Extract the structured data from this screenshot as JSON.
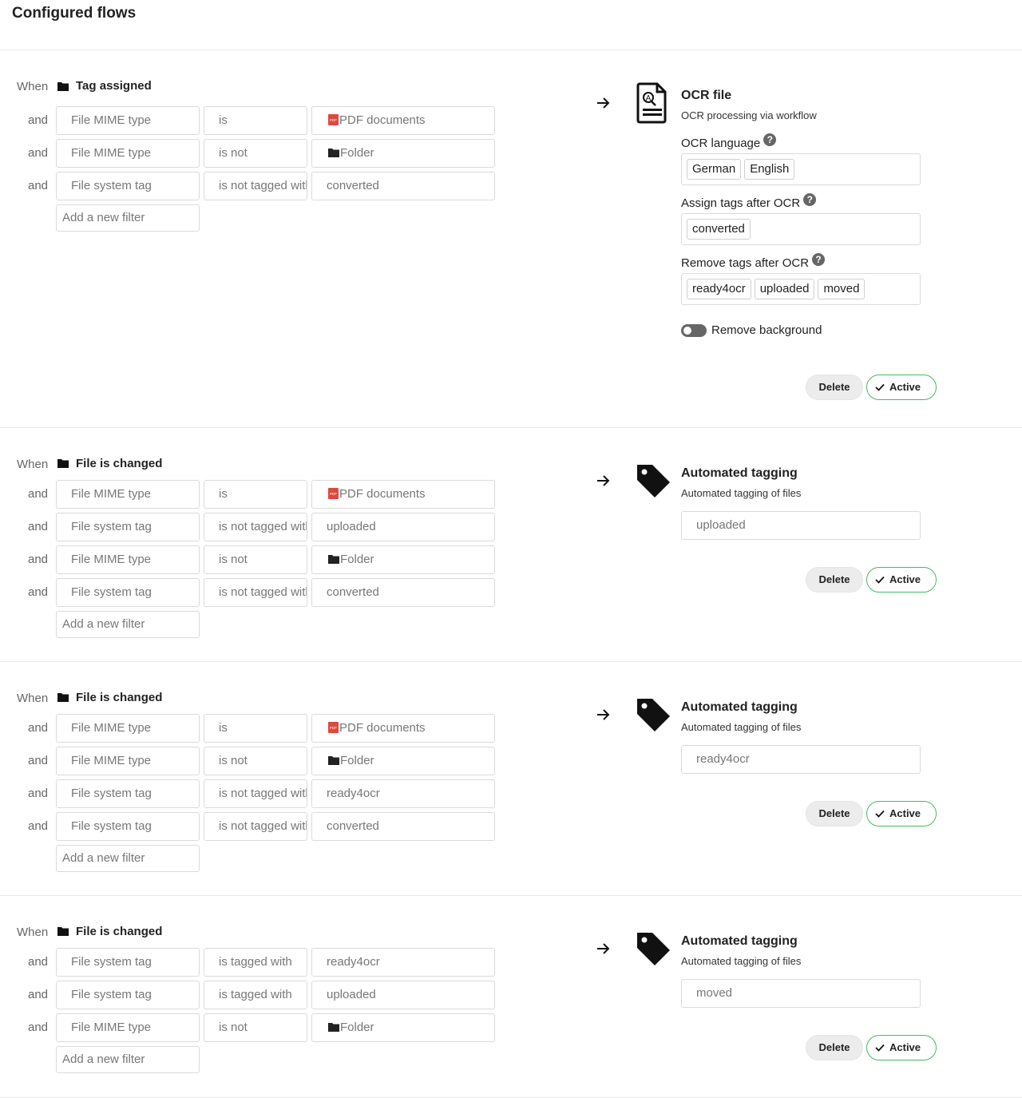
{
  "page": {
    "title": "Configured flows"
  },
  "icons": {
    "folder": "folder-icon",
    "pdf": "pdf-file-icon",
    "arrow": "arrow-right-icon",
    "ocr": "ocr-document-icon",
    "tag": "tag-icon",
    "check": "check-icon",
    "help": "help-icon"
  },
  "colors": {
    "active_border": "#46ba61",
    "pdf_red": "#e0483e"
  },
  "labels": {
    "when": "When",
    "and": "and",
    "add_filter_placeholder": "Add a new filter",
    "delete": "Delete",
    "active": "Active",
    "help": "?"
  },
  "flows": [
    {
      "event": "Tag assigned",
      "checks": [
        {
          "check": "File MIME type",
          "operator": "is",
          "value": "PDF documents",
          "value_icon": "pdf"
        },
        {
          "check": "File MIME type",
          "operator": "is not",
          "value": "Folder",
          "value_icon": "folder"
        },
        {
          "check": "File system tag",
          "operator": "is not tagged with",
          "value": "converted"
        }
      ],
      "operation": {
        "name": "OCR file",
        "description": "OCR processing via workflow",
        "fields": {
          "ocr_language_label": "OCR language",
          "ocr_languages": [
            "German",
            "English"
          ],
          "assign_tags_label": "Assign tags after OCR",
          "assign_tags": [
            "converted"
          ],
          "remove_tags_label": "Remove tags after OCR",
          "remove_tags": [
            "ready4ocr",
            "uploaded",
            "moved"
          ],
          "remove_background_label": "Remove background",
          "remove_background": false
        }
      }
    },
    {
      "event": "File is changed",
      "checks": [
        {
          "check": "File MIME type",
          "operator": "is",
          "value": "PDF documents",
          "value_icon": "pdf"
        },
        {
          "check": "File system tag",
          "operator": "is not tagged with",
          "value": "uploaded"
        },
        {
          "check": "File MIME type",
          "operator": "is not",
          "value": "Folder",
          "value_icon": "folder"
        },
        {
          "check": "File system tag",
          "operator": "is not tagged with",
          "value": "converted"
        }
      ],
      "operation": {
        "name": "Automated tagging",
        "description": "Automated tagging of files",
        "tag": "uploaded"
      }
    },
    {
      "event": "File is changed",
      "checks": [
        {
          "check": "File MIME type",
          "operator": "is",
          "value": "PDF documents",
          "value_icon": "pdf"
        },
        {
          "check": "File MIME type",
          "operator": "is not",
          "value": "Folder",
          "value_icon": "folder"
        },
        {
          "check": "File system tag",
          "operator": "is not tagged with",
          "value": "ready4ocr"
        },
        {
          "check": "File system tag",
          "operator": "is not tagged with",
          "value": "converted"
        }
      ],
      "operation": {
        "name": "Automated tagging",
        "description": "Automated tagging of files",
        "tag": "ready4ocr"
      }
    },
    {
      "event": "File is changed",
      "checks": [
        {
          "check": "File system tag",
          "operator": "is tagged with",
          "value": "ready4ocr"
        },
        {
          "check": "File system tag",
          "operator": "is tagged with",
          "value": "uploaded"
        },
        {
          "check": "File MIME type",
          "operator": "is not",
          "value": "Folder",
          "value_icon": "folder"
        }
      ],
      "operation": {
        "name": "Automated tagging",
        "description": "Automated tagging of files",
        "tag": "moved"
      }
    }
  ]
}
